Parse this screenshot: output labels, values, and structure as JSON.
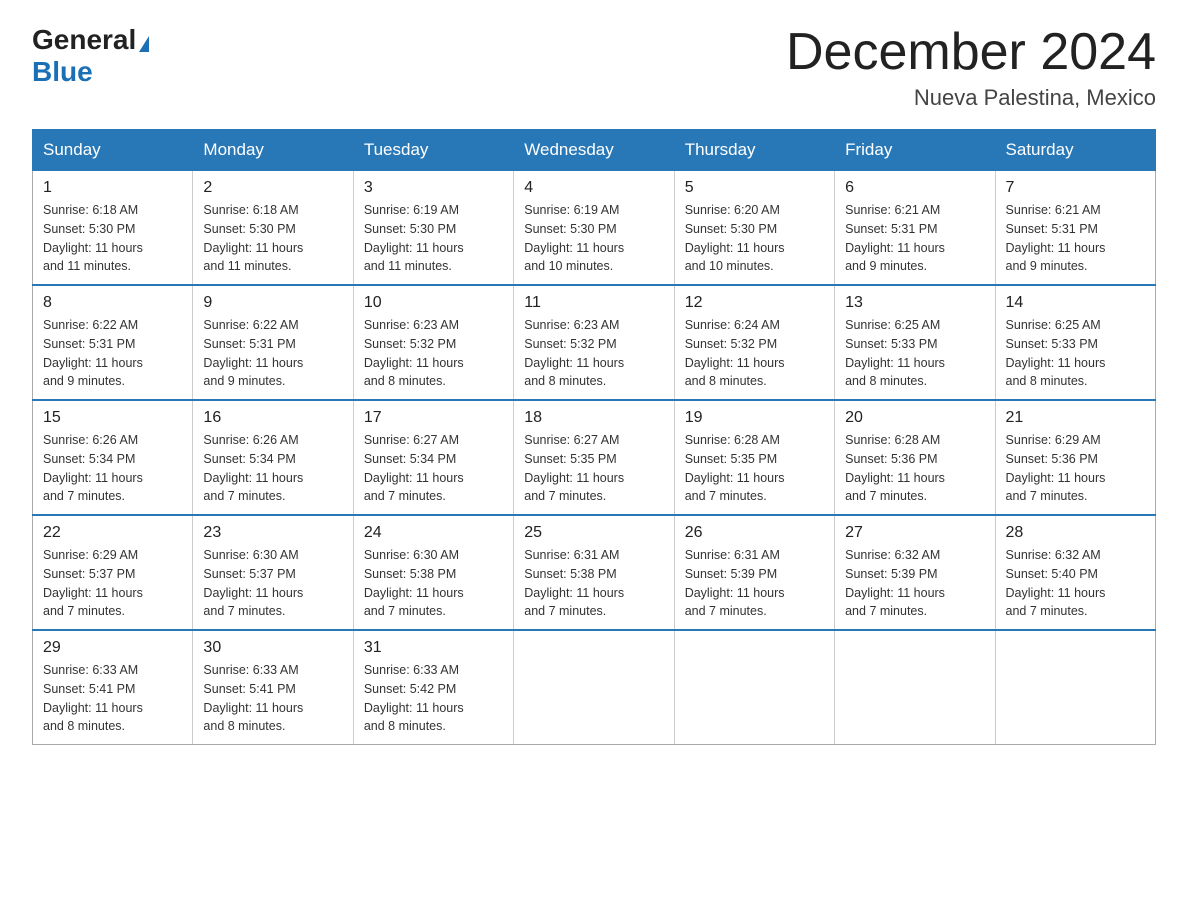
{
  "logo": {
    "general": "General",
    "blue": "Blue"
  },
  "header": {
    "month": "December 2024",
    "location": "Nueva Palestina, Mexico"
  },
  "weekdays": [
    "Sunday",
    "Monday",
    "Tuesday",
    "Wednesday",
    "Thursday",
    "Friday",
    "Saturday"
  ],
  "weeks": [
    [
      {
        "day": "1",
        "info": "Sunrise: 6:18 AM\nSunset: 5:30 PM\nDaylight: 11 hours\nand 11 minutes."
      },
      {
        "day": "2",
        "info": "Sunrise: 6:18 AM\nSunset: 5:30 PM\nDaylight: 11 hours\nand 11 minutes."
      },
      {
        "day": "3",
        "info": "Sunrise: 6:19 AM\nSunset: 5:30 PM\nDaylight: 11 hours\nand 11 minutes."
      },
      {
        "day": "4",
        "info": "Sunrise: 6:19 AM\nSunset: 5:30 PM\nDaylight: 11 hours\nand 10 minutes."
      },
      {
        "day": "5",
        "info": "Sunrise: 6:20 AM\nSunset: 5:30 PM\nDaylight: 11 hours\nand 10 minutes."
      },
      {
        "day": "6",
        "info": "Sunrise: 6:21 AM\nSunset: 5:31 PM\nDaylight: 11 hours\nand 9 minutes."
      },
      {
        "day": "7",
        "info": "Sunrise: 6:21 AM\nSunset: 5:31 PM\nDaylight: 11 hours\nand 9 minutes."
      }
    ],
    [
      {
        "day": "8",
        "info": "Sunrise: 6:22 AM\nSunset: 5:31 PM\nDaylight: 11 hours\nand 9 minutes."
      },
      {
        "day": "9",
        "info": "Sunrise: 6:22 AM\nSunset: 5:31 PM\nDaylight: 11 hours\nand 9 minutes."
      },
      {
        "day": "10",
        "info": "Sunrise: 6:23 AM\nSunset: 5:32 PM\nDaylight: 11 hours\nand 8 minutes."
      },
      {
        "day": "11",
        "info": "Sunrise: 6:23 AM\nSunset: 5:32 PM\nDaylight: 11 hours\nand 8 minutes."
      },
      {
        "day": "12",
        "info": "Sunrise: 6:24 AM\nSunset: 5:32 PM\nDaylight: 11 hours\nand 8 minutes."
      },
      {
        "day": "13",
        "info": "Sunrise: 6:25 AM\nSunset: 5:33 PM\nDaylight: 11 hours\nand 8 minutes."
      },
      {
        "day": "14",
        "info": "Sunrise: 6:25 AM\nSunset: 5:33 PM\nDaylight: 11 hours\nand 8 minutes."
      }
    ],
    [
      {
        "day": "15",
        "info": "Sunrise: 6:26 AM\nSunset: 5:34 PM\nDaylight: 11 hours\nand 7 minutes."
      },
      {
        "day": "16",
        "info": "Sunrise: 6:26 AM\nSunset: 5:34 PM\nDaylight: 11 hours\nand 7 minutes."
      },
      {
        "day": "17",
        "info": "Sunrise: 6:27 AM\nSunset: 5:34 PM\nDaylight: 11 hours\nand 7 minutes."
      },
      {
        "day": "18",
        "info": "Sunrise: 6:27 AM\nSunset: 5:35 PM\nDaylight: 11 hours\nand 7 minutes."
      },
      {
        "day": "19",
        "info": "Sunrise: 6:28 AM\nSunset: 5:35 PM\nDaylight: 11 hours\nand 7 minutes."
      },
      {
        "day": "20",
        "info": "Sunrise: 6:28 AM\nSunset: 5:36 PM\nDaylight: 11 hours\nand 7 minutes."
      },
      {
        "day": "21",
        "info": "Sunrise: 6:29 AM\nSunset: 5:36 PM\nDaylight: 11 hours\nand 7 minutes."
      }
    ],
    [
      {
        "day": "22",
        "info": "Sunrise: 6:29 AM\nSunset: 5:37 PM\nDaylight: 11 hours\nand 7 minutes."
      },
      {
        "day": "23",
        "info": "Sunrise: 6:30 AM\nSunset: 5:37 PM\nDaylight: 11 hours\nand 7 minutes."
      },
      {
        "day": "24",
        "info": "Sunrise: 6:30 AM\nSunset: 5:38 PM\nDaylight: 11 hours\nand 7 minutes."
      },
      {
        "day": "25",
        "info": "Sunrise: 6:31 AM\nSunset: 5:38 PM\nDaylight: 11 hours\nand 7 minutes."
      },
      {
        "day": "26",
        "info": "Sunrise: 6:31 AM\nSunset: 5:39 PM\nDaylight: 11 hours\nand 7 minutes."
      },
      {
        "day": "27",
        "info": "Sunrise: 6:32 AM\nSunset: 5:39 PM\nDaylight: 11 hours\nand 7 minutes."
      },
      {
        "day": "28",
        "info": "Sunrise: 6:32 AM\nSunset: 5:40 PM\nDaylight: 11 hours\nand 7 minutes."
      }
    ],
    [
      {
        "day": "29",
        "info": "Sunrise: 6:33 AM\nSunset: 5:41 PM\nDaylight: 11 hours\nand 8 minutes."
      },
      {
        "day": "30",
        "info": "Sunrise: 6:33 AM\nSunset: 5:41 PM\nDaylight: 11 hours\nand 8 minutes."
      },
      {
        "day": "31",
        "info": "Sunrise: 6:33 AM\nSunset: 5:42 PM\nDaylight: 11 hours\nand 8 minutes."
      },
      null,
      null,
      null,
      null
    ]
  ]
}
